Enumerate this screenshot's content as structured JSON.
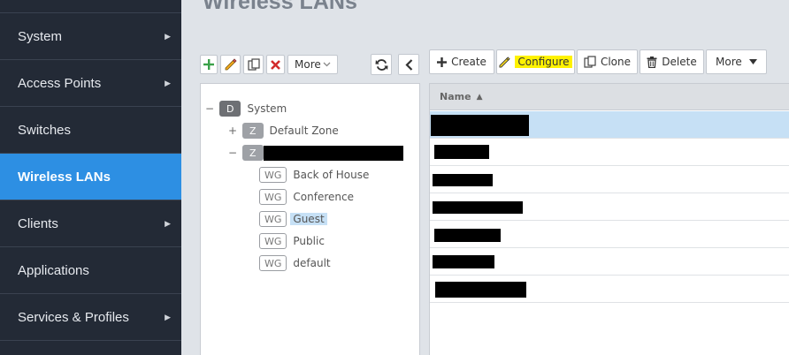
{
  "sidebar": {
    "items": [
      {
        "label": "System",
        "arrow": true
      },
      {
        "label": "Access Points",
        "arrow": true
      },
      {
        "label": "Switches",
        "arrow": false
      },
      {
        "label": "Wireless LANs",
        "arrow": false,
        "active": true
      },
      {
        "label": "Clients",
        "arrow": true
      },
      {
        "label": "Applications",
        "arrow": false
      },
      {
        "label": "Services & Profiles",
        "arrow": true
      }
    ]
  },
  "page": {
    "title": "Wireless LANs"
  },
  "tree_toolbar": {
    "more_label": "More"
  },
  "grid_toolbar": {
    "create_label": "Create",
    "configure_label": "Configure",
    "clone_label": "Clone",
    "delete_label": "Delete",
    "more_label": "More"
  },
  "tree": {
    "root": {
      "toggle": "−",
      "badge": "D",
      "label": "System"
    },
    "zone_default": {
      "toggle": "+",
      "badge": "Z",
      "label": "Default Zone"
    },
    "zone_redacted": {
      "toggle": "−",
      "badge": "Z"
    },
    "wlan_groups": [
      {
        "badge": "WG",
        "label": "Back of House"
      },
      {
        "badge": "WG",
        "label": "Conference"
      },
      {
        "badge": "WG",
        "label": "Guest",
        "selected": true
      },
      {
        "badge": "WG",
        "label": "Public"
      },
      {
        "badge": "WG",
        "label": "default"
      }
    ]
  },
  "grid": {
    "columns": [
      {
        "label": "Name",
        "sort": "▲"
      }
    ]
  },
  "colors": {
    "sidebar_bg": "#232a36",
    "sidebar_active": "#2d8fe3",
    "selection": "#c6e0f5",
    "highlight": "#fff200",
    "add_green": "#3aa14a",
    "delete_red": "#d22b2b"
  }
}
